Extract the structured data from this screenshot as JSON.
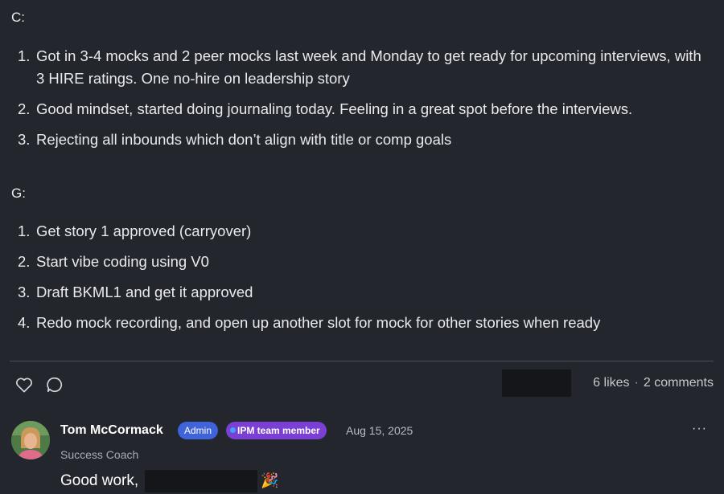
{
  "post": {
    "c_label": "C:",
    "c_items": [
      {
        "num": "1.",
        "text": "Got in 3-4 mocks and 2 peer mocks last week and Monday to get ready for upcoming interviews, with 3 HIRE ratings. One no-hire on leadership story"
      },
      {
        "num": "2.",
        "text": "Good mindset, started doing journaling today. Feeling in a great spot before the interviews."
      },
      {
        "num": "3.",
        "text": "Rejecting all inbounds which don’t align with title or comp goals"
      }
    ],
    "g_label": "G:",
    "g_items": [
      {
        "num": "1.",
        "text": "Get story 1 approved (carryover)"
      },
      {
        "num": "2.",
        "text": "Start vibe coding using V0"
      },
      {
        "num": "3.",
        "text": "Draft BKML1 and get it approved"
      },
      {
        "num": "4.",
        "text": "Redo mock recording, and open up another slot for mock for other stories when ready"
      }
    ]
  },
  "actions": {
    "like_icon": "heart-icon",
    "comment_icon": "comment-bubble-icon",
    "likes": "6 likes",
    "separator": "·",
    "comments": "2 comments"
  },
  "comment": {
    "author": "Tom McCormack",
    "admin_badge": "Admin",
    "team_badge": "IPM team member",
    "date": "Aug 15, 2025",
    "more": "···",
    "role": "Success Coach",
    "text": "Good work,",
    "emoji": "🎉"
  },
  "colors": {
    "background": "#24262d",
    "admin_badge": "#3f63d8",
    "team_badge": "#7b3fd4"
  }
}
